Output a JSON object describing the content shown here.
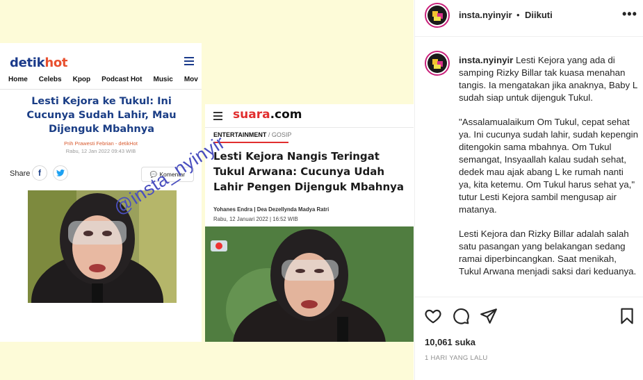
{
  "media": {
    "detik": {
      "logo_a": "detik",
      "logo_b": "hot",
      "nav": [
        "Home",
        "Celebs",
        "Kpop",
        "Podcast Hot",
        "Music",
        "Mov"
      ],
      "title": "Lesti Kejora ke Tukul: Ini Cucunya Sudah Lahir, Mau Dijenguk Mbahnya",
      "author": "Prih Prawesti Febrian - detikHot",
      "date": "Rabu, 12 Jan 2022 09:43 WIB",
      "share_label": "Share",
      "komentar": "Komentar"
    },
    "suara": {
      "logo_a": "suara",
      "logo_b": ".com",
      "category": "ENTERTAINMENT",
      "subcategory": " / GOSIP",
      "title": "Lesti Kejora Nangis Teringat Tukul Arwana: Cucunya Udah Lahir Pengen Dijenguk Mbahnya",
      "author": "Yohanes Endra | Dea Dezellyndа Madya Ratri",
      "date": "Rabu, 12 Januari 2022 | 16:52 WIB"
    },
    "watermark": "@insta_nyinyir"
  },
  "post": {
    "username": "insta.nyinyir",
    "dot": "•",
    "follow_status": "Diikuti",
    "more_icon": "more-horizontal-icon",
    "caption_user": "insta.nyinyir",
    "caption_p1": "Lesti Kejora yang ada di samping Rizky Billar tak kuasa menahan tangis. Ia mengatakan jika anaknya, Baby L sudah siap untuk dijenguk Tukul.",
    "caption_p2": "\"Assalamualaikum Om Tukul, cepat sehat ya. Ini cucunya sudah lahir, sudah kepengin ditengokin sama mbahnya. Om Tukul semangat, Insyaallah kalau sudah sehat, dedek mau ajak abang L ke rumah nanti ya, kita ketemu. Om Tukul harus sehat ya,\" tutur Lesti Kejora sambil mengusap air matanya.",
    "caption_p3": "Lesti Kejora dan Rizky Billar adalah salah satu pasangan yang belakangan sedang ramai diperbincangkan. Saat menikah, Tukul Arwana menjadi saksi dari keduanya.",
    "likes": "10,061 suka",
    "time_ago": "1 HARI YANG LALU"
  }
}
